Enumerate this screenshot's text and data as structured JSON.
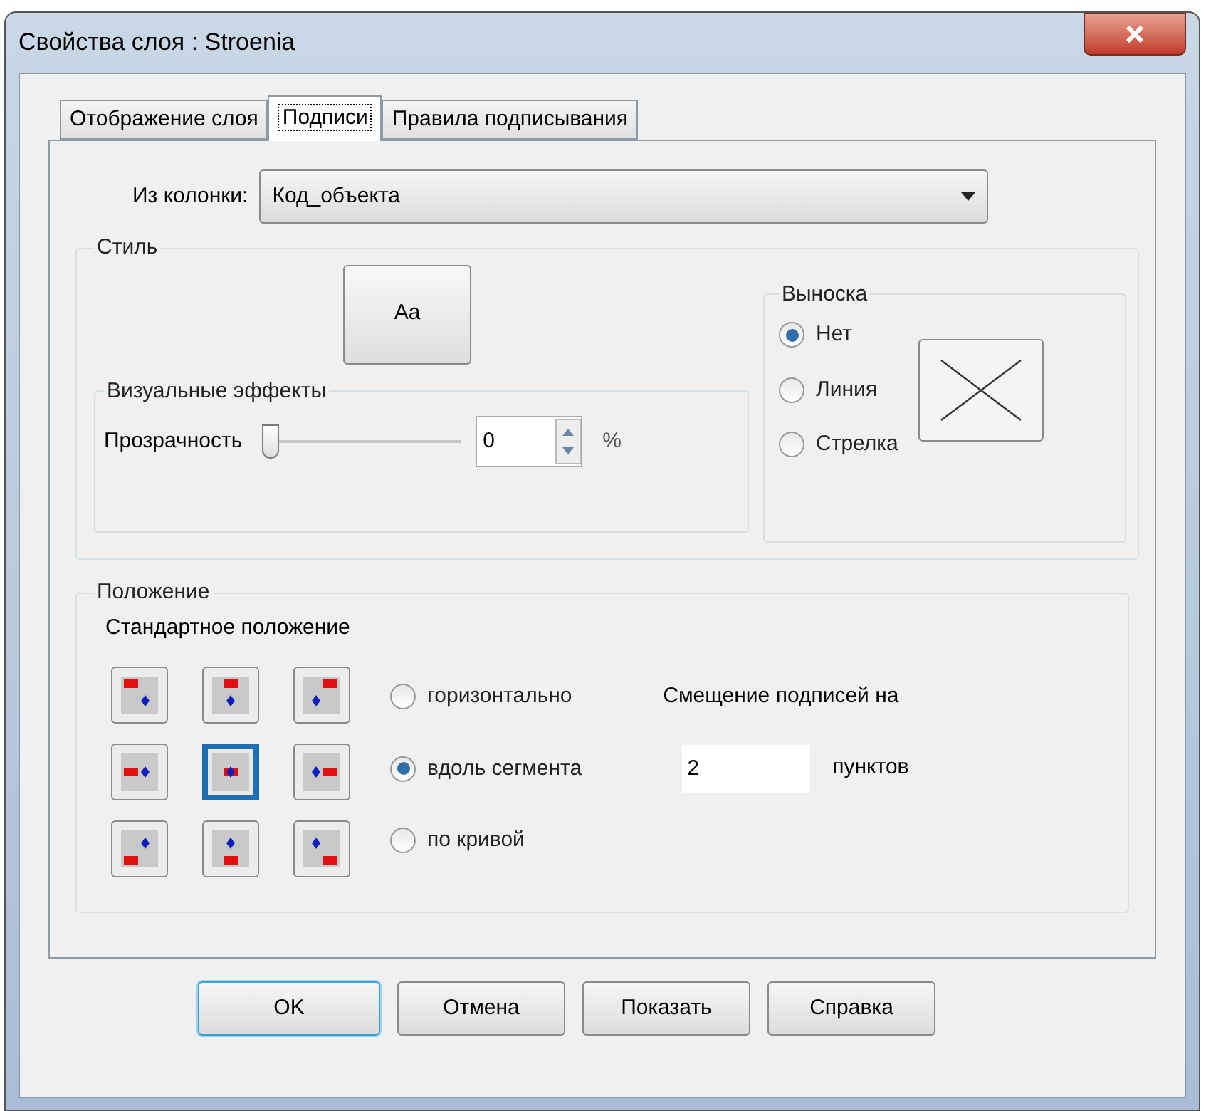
{
  "window": {
    "title": "Свойства слоя  : Stroenia"
  },
  "tabs": [
    {
      "label": "Отображение слоя",
      "selected": false
    },
    {
      "label": "Подписи",
      "selected": true
    },
    {
      "label": "Правила подписывания",
      "selected": false
    }
  ],
  "column": {
    "label": "Из колонки:",
    "value": "Код_объекта"
  },
  "style": {
    "title": "Стиль",
    "font_button": "Aa",
    "effects": {
      "title": "Визуальные эффекты",
      "label": "Прозрачность",
      "level": 0,
      "value": "0",
      "unit": "%"
    }
  },
  "callout": {
    "title": "Выноска",
    "options": [
      {
        "label": "Нет",
        "selected": true
      },
      {
        "label": "Линия",
        "selected": false
      },
      {
        "label": "Стрелка",
        "selected": false
      }
    ]
  },
  "position": {
    "title": "Положение",
    "subtitle": "Стандартное положение",
    "anchors": [
      {
        "selected": false
      },
      {
        "selected": false
      },
      {
        "selected": false
      },
      {
        "selected": false
      },
      {
        "selected": true
      },
      {
        "selected": false
      },
      {
        "selected": false
      },
      {
        "selected": false
      },
      {
        "selected": false
      }
    ],
    "orientation": [
      {
        "label": "горизонтально",
        "selected": false
      },
      {
        "label": "вдоль сегмента",
        "selected": true
      },
      {
        "label": "по кривой",
        "selected": false
      }
    ],
    "offset_label": "Смещение подписей на",
    "offset_value": "2",
    "offset_unit": "пунктов"
  },
  "buttons": [
    {
      "label": "OK",
      "default": true
    },
    {
      "label": "Отмена",
      "default": false
    },
    {
      "label": "Показать",
      "default": false
    },
    {
      "label": "Справка",
      "default": false
    }
  ]
}
